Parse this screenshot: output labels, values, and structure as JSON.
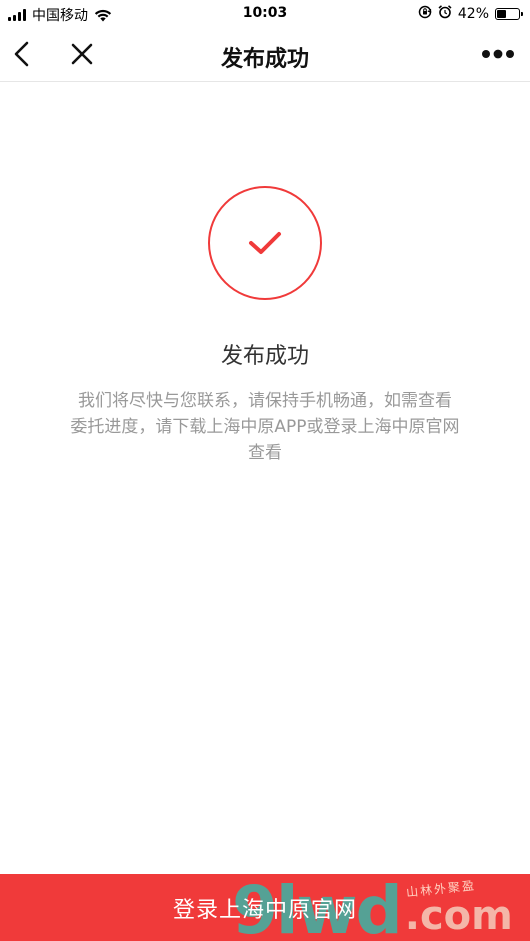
{
  "status_bar": {
    "carrier": "中国移动",
    "time": "10:03",
    "battery_percent": "42%",
    "battery_level": 0.42,
    "icons": [
      "signal-icon",
      "wifi-icon",
      "rotation-lock-icon",
      "alarm-icon",
      "battery-icon"
    ]
  },
  "nav": {
    "title": "发布成功",
    "back_icon": "chevron-left-icon",
    "close_icon": "close-icon",
    "more_icon": "more-icon"
  },
  "success": {
    "icon": "check-icon",
    "title": "发布成功",
    "description": "我们将尽快与您联系，请保持手机畅通，如需查看委托进度，请下载上海中原APP或登录上海中原官网查看"
  },
  "bottom_button": {
    "label": "登录上海中原官网"
  },
  "watermark": {
    "main": "9lwd",
    "domain": ".com",
    "slogan": "山林外聚盈"
  },
  "colors": {
    "accent": "#f03a3a",
    "text_primary": "#333333",
    "text_secondary": "#999999",
    "divider": "#e6e6e6"
  }
}
